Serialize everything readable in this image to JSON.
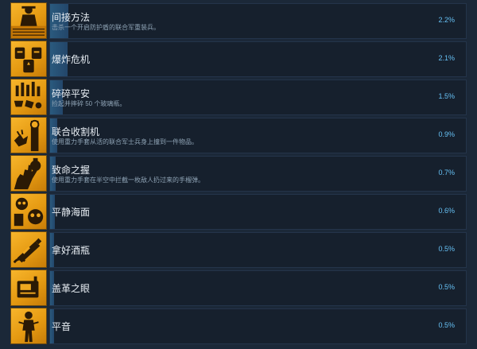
{
  "achievements": [
    {
      "name": "间接方法",
      "description": "击杀一个开启防护盾的联合军重装兵。",
      "percent_label": "2.2%",
      "percent": 2.2,
      "icon": "soldier-icon"
    },
    {
      "name": "爆炸危机",
      "description": "",
      "percent_label": "2.1%",
      "percent": 2.1,
      "icon": "barrels-icon"
    },
    {
      "name": "碎碎平安",
      "description": "捡起并摔碎 50 个玻璃瓶。",
      "percent_label": "1.5%",
      "percent": 1.5,
      "icon": "bottles-icon"
    },
    {
      "name": "联合收割机",
      "description": "使用重力手套从活的联合军士兵身上撞到一件物品。",
      "percent_label": "0.9%",
      "percent": 0.9,
      "icon": "soldier-grab-icon"
    },
    {
      "name": "致命之握",
      "description": "使用重力手套在半空中拦截一枚敌人扔过来的手榴弹。",
      "percent_label": "0.7%",
      "percent": 0.7,
      "icon": "grenade-hand-icon"
    },
    {
      "name": "平静海面",
      "description": "",
      "percent_label": "0.6%",
      "percent": 0.6,
      "icon": "faces-icon"
    },
    {
      "name": "拿好酒瓶",
      "description": "",
      "percent_label": "0.5%",
      "percent": 0.5,
      "icon": "bottle-hand-icon"
    },
    {
      "name": "盖革之眼",
      "description": "",
      "percent_label": "0.5%",
      "percent": 0.5,
      "icon": "geiger-icon"
    },
    {
      "name": "平音",
      "description": "",
      "percent_label": "0.5%",
      "percent": 0.5,
      "icon": "figure-icon"
    }
  ],
  "colors": {
    "background": "#1b2838",
    "icon_gold": "#f0a820",
    "progress_fill": "#2a5a7e",
    "percent_text": "#66c0f4"
  }
}
